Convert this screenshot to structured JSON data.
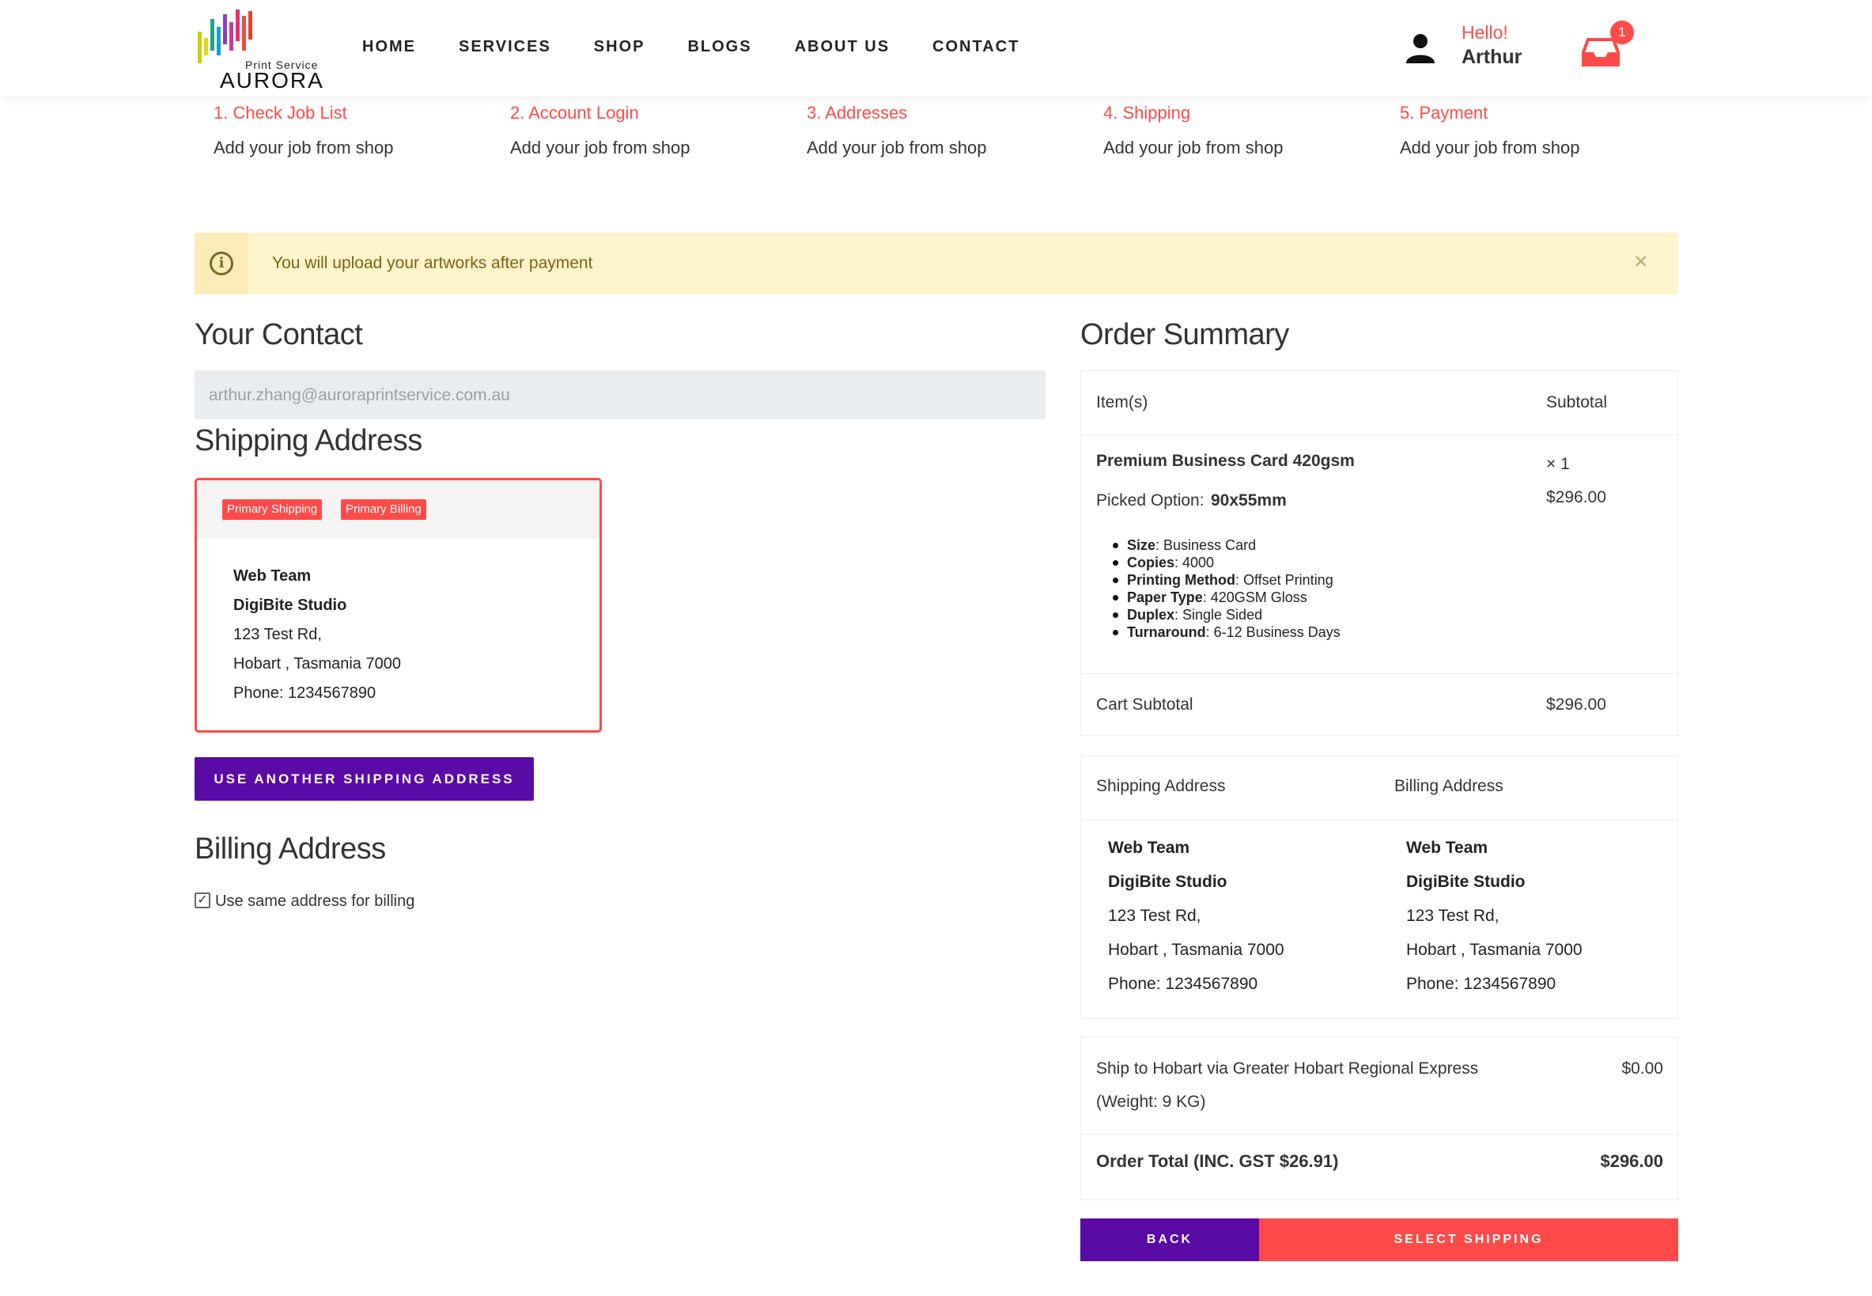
{
  "brand": {
    "logo_small": "Print Service",
    "logo_big": "AURORA"
  },
  "nav": [
    "HOME",
    "SERVICES",
    "SHOP",
    "BLOGS",
    "ABOUT US",
    "CONTACT"
  ],
  "user": {
    "greeting": "Hello!",
    "name": "Arthur",
    "cart_count": "1"
  },
  "steps": [
    {
      "title": "1. Check Job List",
      "sub": "Add your job from shop"
    },
    {
      "title": "2. Account Login",
      "sub": "Add your job from shop"
    },
    {
      "title": "3. Addresses",
      "sub": "Add your job from shop"
    },
    {
      "title": "4. Shipping",
      "sub": "Add your job from shop"
    },
    {
      "title": "5. Payment",
      "sub": "Add your job from shop"
    }
  ],
  "alert": {
    "text": "You will upload your artworks after payment",
    "close": "×"
  },
  "contact": {
    "heading": "Your Contact",
    "email": "arthur.zhang@auroraprintservice.com.au"
  },
  "shipping": {
    "heading": "Shipping Address",
    "badges": [
      "Primary Shipping",
      "Primary Billing"
    ],
    "address": [
      "Web Team",
      "DigiBite Studio",
      "123 Test Rd,",
      "Hobart , Tasmania 7000",
      "Phone: 1234567890"
    ],
    "another_button": "USE ANOTHER SHIPPING ADDRESS"
  },
  "billing": {
    "heading": "Billing Address",
    "same_label": "Use same address for billing",
    "same_checked": true
  },
  "summary": {
    "heading": "Order Summary",
    "col_items": "Item(s)",
    "col_subtotal": "Subtotal",
    "product_name": "Premium Business Card 420gsm",
    "picked_label": "Picked Option:",
    "picked_value": "90x55mm",
    "qty": "× 1",
    "price": "$296.00",
    "specs": [
      {
        "key": "Size",
        "value": ": Business Card"
      },
      {
        "key": "Copies",
        "value": ": 4000"
      },
      {
        "key": "Printing Method",
        "value": ": Offset Printing"
      },
      {
        "key": "Paper Type",
        "value": ": 420GSM Gloss"
      },
      {
        "key": "Duplex",
        "value": ": Single Sided"
      },
      {
        "key": "Turnaround",
        "value": ": 6-12 Business Days"
      }
    ],
    "cart_subtotal_label": "Cart Subtotal",
    "cart_subtotal_value": "$296.00",
    "ship_addr_label": "Shipping Address",
    "bill_addr_label": "Billing Address",
    "ship_addr": [
      "Web Team",
      "DigiBite Studio",
      "123 Test Rd,",
      "Hobart , Tasmania 7000",
      "Phone: 1234567890"
    ],
    "bill_addr": [
      "Web Team",
      "DigiBite Studio",
      "123 Test Rd,",
      "Hobart , Tasmania 7000",
      "Phone: 1234567890"
    ],
    "ship_method_line1": "Ship to Hobart via Greater Hobart Regional Express",
    "ship_method_line2": "(Weight: 9 KG)",
    "ship_cost": "$0.00",
    "total_label": "Order Total (INC. GST $26.91)",
    "total_value": "$296.00"
  },
  "buttons": {
    "back": "BACK",
    "select_shipping": "SELECT SHIPPING"
  },
  "colors": {
    "accent_red": "#ff4a4a",
    "purple": "#5a0aa5",
    "alert_bg": "#fff3cd"
  }
}
